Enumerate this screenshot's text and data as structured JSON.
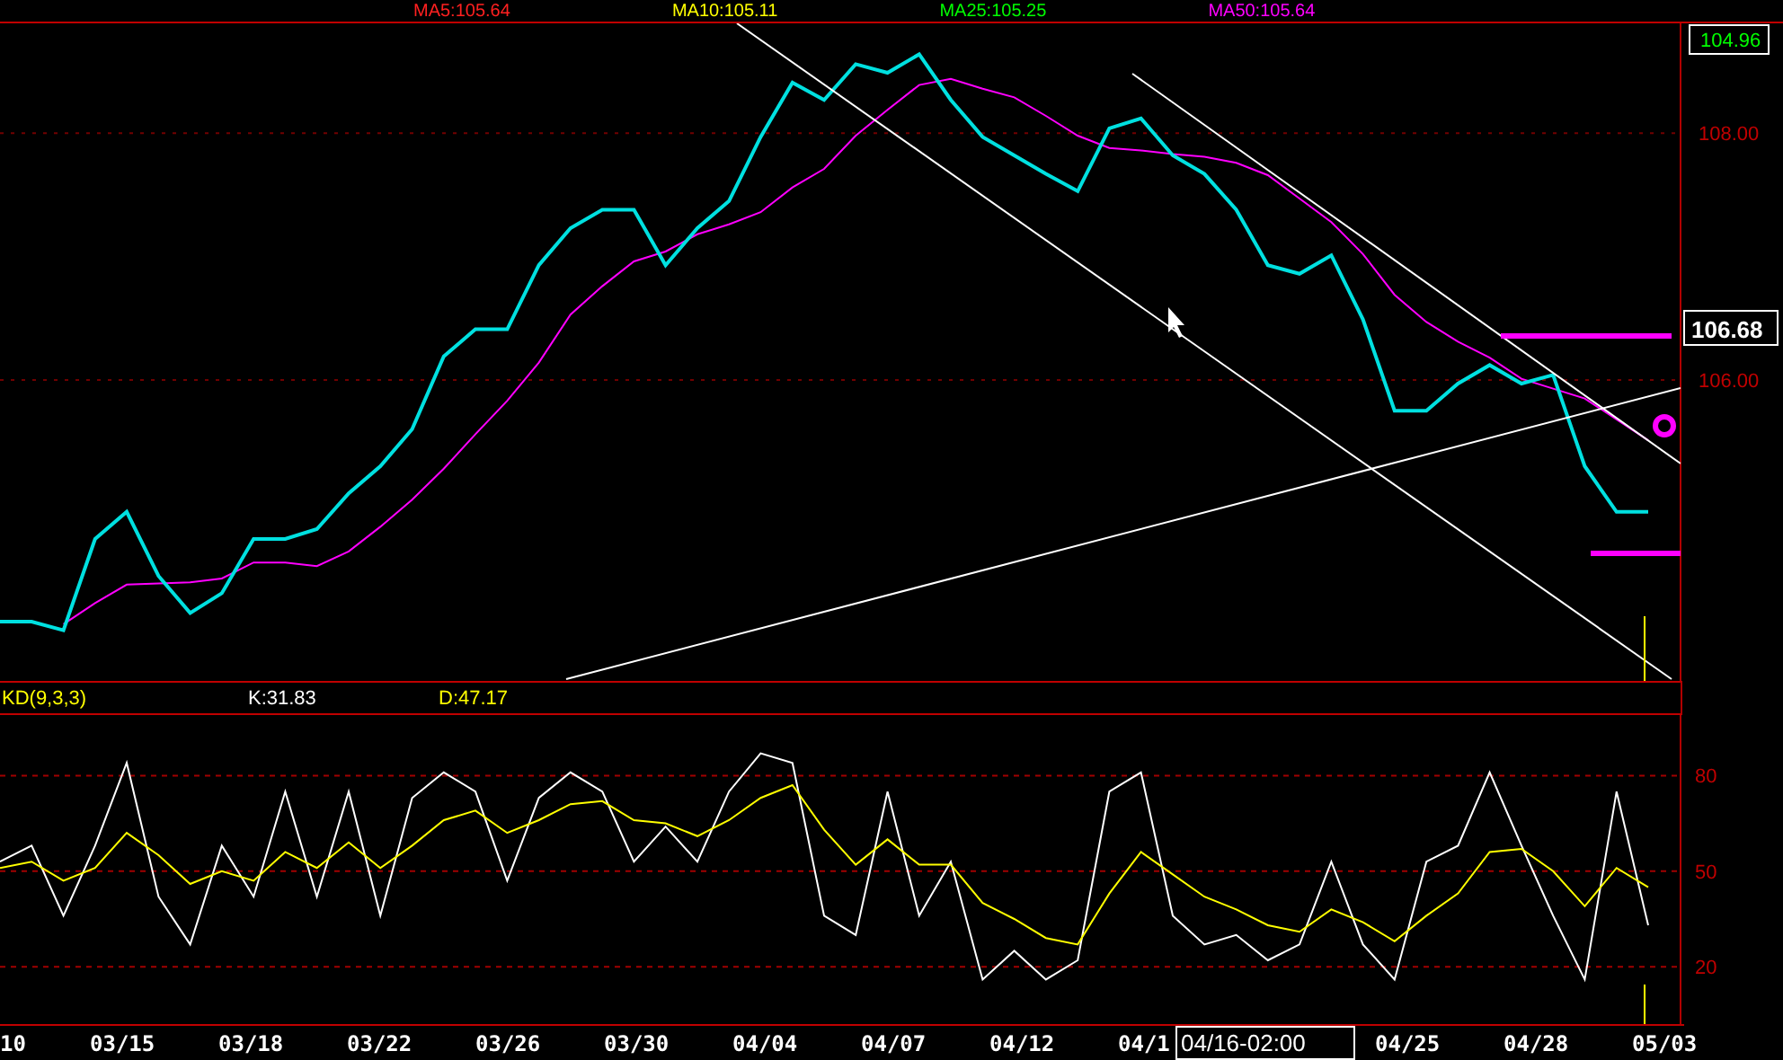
{
  "legend": [
    {
      "label": "MA5:105.64",
      "color": "#ff2020"
    },
    {
      "label": "MA10:105.11",
      "color": "#ffff00"
    },
    {
      "label": "MA25:105.25",
      "color": "#00ff00"
    },
    {
      "label": "MA50:105.64",
      "color": "#ff00ff"
    }
  ],
  "price_chart": {
    "top_label": "104.96",
    "last_price": "106.68",
    "chart_data": {
      "type": "line",
      "grid": true,
      "ylim": [
        103.56,
        108.89
      ],
      "yticks": [
        {
          "value": 106,
          "label": "106.00"
        },
        {
          "value": 108,
          "label": "108.00"
        }
      ],
      "series": [
        {
          "color": "#ff00ff",
          "values": [
            null,
            null,
            104.02,
            104.19,
            104.34,
            104.35,
            104.36,
            104.39,
            104.52,
            104.52,
            104.49,
            104.61,
            104.81,
            105.03,
            105.28,
            105.56,
            105.83,
            106.14,
            106.53,
            106.76,
            106.96,
            107.04,
            107.18,
            107.26,
            107.36,
            107.56,
            107.71,
            107.98,
            108.19,
            108.39,
            108.44,
            108.36,
            108.29,
            108.14,
            107.98,
            107.88,
            107.86,
            107.83,
            107.81,
            107.76,
            107.66,
            107.47,
            107.28,
            107.02,
            106.69,
            106.47,
            106.31,
            106.18,
            106.01,
            105.93,
            105.85,
            105.68,
            105.51
          ]
        },
        {
          "color": "#00e0e0",
          "values": [
            104.04,
            104.04,
            103.97,
            104.71,
            104.93,
            104.41,
            104.11,
            104.27,
            104.71,
            104.71,
            104.79,
            105.08,
            105.3,
            105.6,
            106.19,
            106.41,
            106.41,
            106.93,
            107.23,
            107.38,
            107.38,
            106.93,
            107.23,
            107.45,
            107.97,
            108.41,
            108.27,
            108.56,
            108.49,
            108.64,
            108.27,
            107.97,
            107.82,
            107.67,
            107.53,
            108.04,
            108.12,
            107.82,
            107.67,
            107.38,
            106.93,
            106.86,
            107.01,
            106.49,
            105.75,
            105.75,
            105.97,
            106.12,
            105.97,
            106.04,
            105.3,
            104.93,
            104.93
          ]
        }
      ]
    }
  },
  "kd_chart": {
    "title": "KD(9,3,3)",
    "k_reading": "K:31.83",
    "d_reading": "D:47.17",
    "chart_data": {
      "type": "line",
      "grid": true,
      "ylim": [
        2,
        99
      ],
      "yticks": [
        20,
        50,
        80
      ],
      "series": [
        {
          "color": "#ffffff",
          "values": [
            53,
            58,
            36,
            58,
            84,
            42,
            27,
            58,
            42,
            75,
            42,
            75,
            36,
            73,
            81,
            75,
            47,
            73,
            81,
            75,
            53,
            64,
            53,
            75,
            87,
            84,
            36,
            30,
            75,
            36,
            53,
            16,
            25,
            16,
            22,
            75,
            81,
            36,
            27,
            30,
            22,
            27,
            53,
            27,
            16,
            53,
            58,
            81,
            58,
            36,
            16,
            75,
            33
          ]
        },
        {
          "color": "#ffff00",
          "values": [
            51,
            53,
            47,
            51,
            62,
            55,
            46,
            50,
            47,
            56,
            51,
            59,
            51,
            58,
            66,
            69,
            62,
            66,
            71,
            72,
            66,
            65,
            61,
            66,
            73,
            77,
            63,
            52,
            60,
            52,
            52,
            40,
            35,
            29,
            27,
            43,
            56,
            49,
            42,
            38,
            33,
            31,
            38,
            34,
            28,
            36,
            43,
            56,
            57,
            50,
            39,
            51,
            45
          ]
        }
      ]
    }
  },
  "date_axis": {
    "labels": [
      "10",
      "03/15",
      "03/18",
      "03/22",
      "03/26",
      "03/30",
      "04/04",
      "04/07",
      "04/12",
      "04/1",
      "04/25",
      "04/28",
      "05/03"
    ],
    "cursor_label": "04/16-02:00"
  }
}
